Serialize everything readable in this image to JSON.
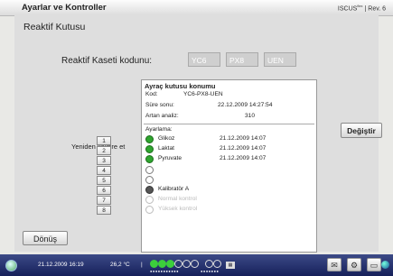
{
  "window": {
    "title": "Ayarlar ve Kontroller",
    "brand": "ISCUS",
    "brand_sup": "flex",
    "rev": "| Rev. 6"
  },
  "page": {
    "title": "Reaktif Kutusu"
  },
  "kit_code": {
    "label": "Reaktif Kaseti kodunu:",
    "part1": "YC6",
    "part2": "PX8",
    "part3": "UEN"
  },
  "panel": {
    "header": "Ayraç kutusu konumu",
    "kod_label": "Kod:",
    "kod_value": "YC6-PX8-UEN",
    "expiry_label": "Süre sonu:",
    "expiry_value": "22.12.2009 14:27:54",
    "remaining_label": "Artan analiz:",
    "remaining_value": "310",
    "settings_label": "Ayarlama:",
    "slots": [
      {
        "state": "ok",
        "label": "Glikoz",
        "time": "21.12.2009 14:07"
      },
      {
        "state": "ok",
        "label": "Laktat",
        "time": "21.12.2009 14:07"
      },
      {
        "state": "ok",
        "label": "Pyruvate",
        "time": "21.12.2009 14:07"
      },
      {
        "state": "empty",
        "label": "",
        "time": ""
      },
      {
        "state": "empty",
        "label": "",
        "time": ""
      },
      {
        "state": "dark",
        "label": "Kalibratör A",
        "time": ""
      },
      {
        "state": "faint",
        "label": "Normal kontrol",
        "time": ""
      },
      {
        "state": "faint",
        "label": "Yüksek kontrol",
        "time": ""
      }
    ]
  },
  "buttons": {
    "change": "Değiştir",
    "back": "Dönüş"
  },
  "recalibrate": {
    "label": "Yeniden kalibre et",
    "buttons": [
      "1",
      "2",
      "3",
      "4",
      "5",
      "6",
      "7",
      "8"
    ]
  },
  "status": {
    "datetime": "21.12.2009 16:19",
    "temperature": "26,2 °C",
    "separator": "|"
  }
}
